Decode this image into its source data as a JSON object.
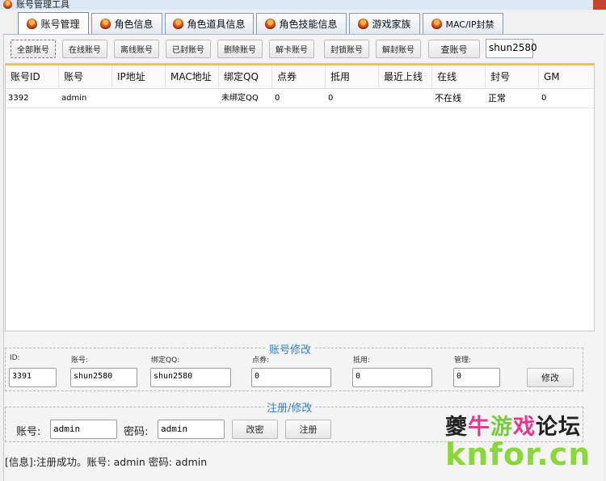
{
  "window": {
    "title": "账号管理工具"
  },
  "tabs": [
    {
      "label": "账号管理",
      "active": true
    },
    {
      "label": "角色信息"
    },
    {
      "label": "角色道具信息"
    },
    {
      "label": "角色技能信息"
    },
    {
      "label": "游戏家族"
    },
    {
      "label": "MAC/IP封禁"
    }
  ],
  "toolbar": {
    "buttons": [
      "全部账号",
      "在线账号",
      "离线账号",
      "已封账号",
      "删除账号",
      "解卡账号",
      "封锁账号",
      "解封账号",
      "查账号"
    ],
    "search_value": "shun2580"
  },
  "table": {
    "columns": [
      "账号ID",
      "账号",
      "IP地址",
      "MAC地址",
      "绑定QQ",
      "点券",
      "抵用",
      "最近上线",
      "在线",
      "封号",
      "GM"
    ],
    "rows": [
      [
        "3392",
        "admin",
        "",
        "",
        "未绑定QQ",
        "0",
        "0",
        "",
        "不在线",
        "正常",
        "0"
      ]
    ]
  },
  "edit": {
    "title": "账号修改",
    "fields": [
      {
        "label": "ID:",
        "value": "3391"
      },
      {
        "label": "账号:",
        "value": "shun2580"
      },
      {
        "label": "绑定QQ:",
        "value": "shun2580"
      },
      {
        "label": "点券:",
        "value": "0"
      },
      {
        "label": "抵用:",
        "value": "0"
      },
      {
        "label": "管理:",
        "value": "0"
      }
    ],
    "modify_label": "修改"
  },
  "register": {
    "title": "注册/修改",
    "account_label": "账号:",
    "account_value": "admin",
    "password_label": "密码:",
    "password_value": "admin",
    "change_pwd_label": "改密",
    "register_label": "注册"
  },
  "status": "[信息]:注册成功。账号: admin 密码: admin",
  "watermark": {
    "cn": "夔牛游戏论坛",
    "en": "knfor.cn"
  },
  "colors": {
    "group_title": "#2f7fc0",
    "header_accent": "#f1ba62",
    "watermark_green": "#8bd63a"
  }
}
